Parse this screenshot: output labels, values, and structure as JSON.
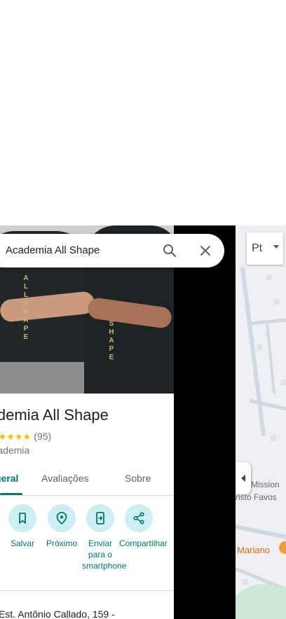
{
  "search": {
    "query": "Academia All Shape"
  },
  "place": {
    "title": "Academia All Shape",
    "stars": "★★★★★",
    "review_count": "(95)",
    "category": "Academia",
    "address": "Est. Antônio Callado, 159 -"
  },
  "tabs": [
    {
      "label": "Visão geral",
      "active": true
    },
    {
      "label": "Avaliações",
      "active": false
    },
    {
      "label": "Sobre",
      "active": false
    }
  ],
  "actions": [
    {
      "label": "Salvar",
      "icon": "bookmark-icon"
    },
    {
      "label": "Próximo",
      "icon": "nearby-icon"
    },
    {
      "label": "Enviar para o smartphone",
      "icon": "send-to-phone-icon"
    },
    {
      "label": "Compartilhar",
      "icon": "share-icon"
    }
  ],
  "map": {
    "language_button": "Pt",
    "labels": [
      "Mission",
      "risto Favos",
      "Mariano"
    ]
  },
  "colors": {
    "accent": "#00796b",
    "action_bg": "#cdeef3",
    "star": "#fbbc04"
  }
}
